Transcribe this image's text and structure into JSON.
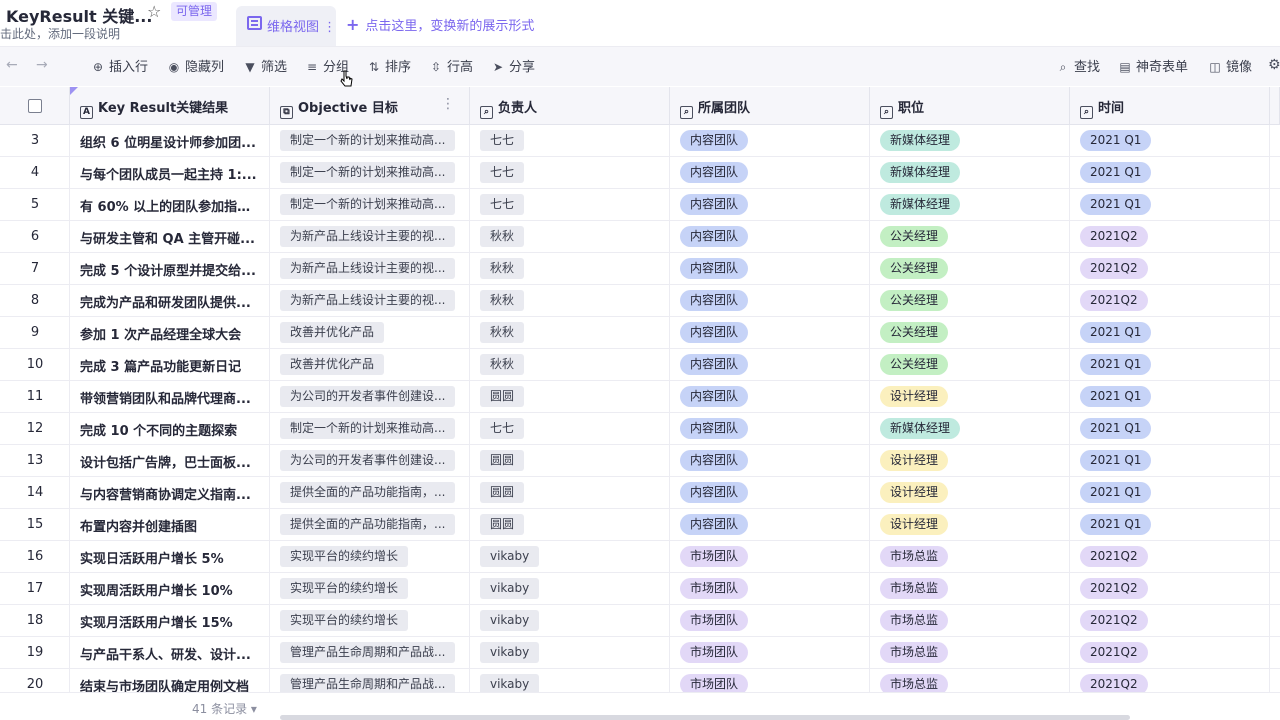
{
  "header": {
    "title": "KeyResult 关键...",
    "badge": "可管理",
    "subtitle": "击此处，添加一段说明",
    "view_tab": "维格视图",
    "add_view": "点击这里，变换新的展示形式"
  },
  "toolbar": {
    "insert_row": "插入行",
    "hide_cols": "隐藏列",
    "filter": "筛选",
    "group": "分组",
    "sort": "排序",
    "row_height": "行高",
    "share": "分享",
    "search": "查找",
    "form": "神奇表单",
    "mirror": "镜像"
  },
  "columns": {
    "kr": "Key Result关键结果",
    "objective": "Objective 目标",
    "owner": "负责人",
    "team": "所属团队",
    "position": "职位",
    "time": "时间"
  },
  "colors": {
    "accent": "#7b67ee",
    "team_content": "#c6d3f7",
    "team_market": "#e2d8f7",
    "pos_newmedia": "#bfeadf",
    "pos_pr": "#c3efc3",
    "pos_design": "#fbf0be",
    "pos_market": "#e2d8f7",
    "time_q1": "#c6d3f7",
    "time_q2": "#e2d8f7"
  },
  "rows": [
    {
      "num": "3",
      "kr": "组织 6 位明星设计师参加团...",
      "obj": "制定一个新的计划来推动高...",
      "owner": "七七",
      "team": "内容团队",
      "pos": "新媒体经理",
      "time": "2021 Q1"
    },
    {
      "num": "4",
      "kr": "与每个团队成员一起主持 1:...",
      "obj": "制定一个新的计划来推动高...",
      "owner": "七七",
      "team": "内容团队",
      "pos": "新媒体经理",
      "time": "2021 Q1"
    },
    {
      "num": "5",
      "kr": "有 60% 以上的团队参加指导...",
      "obj": "制定一个新的计划来推动高...",
      "owner": "七七",
      "team": "内容团队",
      "pos": "新媒体经理",
      "time": "2021 Q1"
    },
    {
      "num": "6",
      "kr": "与研发主管和 QA 主管开碰...",
      "obj": "为新产品上线设计主要的视...",
      "owner": "秋秋",
      "team": "内容团队",
      "pos": "公关经理",
      "time": "2021Q2"
    },
    {
      "num": "7",
      "kr": "完成 5 个设计原型并提交给...",
      "obj": "为新产品上线设计主要的视...",
      "owner": "秋秋",
      "team": "内容团队",
      "pos": "公关经理",
      "time": "2021Q2"
    },
    {
      "num": "8",
      "kr": "完成为产品和研发团队提供...",
      "obj": "为新产品上线设计主要的视...",
      "owner": "秋秋",
      "team": "内容团队",
      "pos": "公关经理",
      "time": "2021Q2"
    },
    {
      "num": "9",
      "kr": "参加 1 次产品经理全球大会",
      "obj": "改善并优化产品",
      "owner": "秋秋",
      "team": "内容团队",
      "pos": "公关经理",
      "time": "2021 Q1"
    },
    {
      "num": "10",
      "kr": "完成 3 篇产品功能更新日记",
      "obj": "改善并优化产品",
      "owner": "秋秋",
      "team": "内容团队",
      "pos": "公关经理",
      "time": "2021 Q1"
    },
    {
      "num": "11",
      "kr": "带领营销团队和品牌代理商...",
      "obj": "为公司的开发者事件创建设...",
      "owner": "圆圆",
      "team": "内容团队",
      "pos": "设计经理",
      "time": "2021 Q1"
    },
    {
      "num": "12",
      "kr": "完成 10 个不同的主题探索",
      "obj": "制定一个新的计划来推动高...",
      "owner": "七七",
      "team": "内容团队",
      "pos": "新媒体经理",
      "time": "2021 Q1"
    },
    {
      "num": "13",
      "kr": "设计包括广告牌，巴士面板...",
      "obj": "为公司的开发者事件创建设...",
      "owner": "圆圆",
      "team": "内容团队",
      "pos": "设计经理",
      "time": "2021 Q1"
    },
    {
      "num": "14",
      "kr": "与内容营销商协调定义指南...",
      "obj": "提供全面的产品功能指南，...",
      "owner": "圆圆",
      "team": "内容团队",
      "pos": "设计经理",
      "time": "2021 Q1"
    },
    {
      "num": "15",
      "kr": "布置内容并创建插图",
      "obj": "提供全面的产品功能指南，...",
      "owner": "圆圆",
      "team": "内容团队",
      "pos": "设计经理",
      "time": "2021 Q1"
    },
    {
      "num": "16",
      "kr": "实现日活跃用户增长 5%",
      "obj": "实现平台的续约增长",
      "owner": "vikaby",
      "team": "市场团队",
      "pos": "市场总监",
      "time": "2021Q2"
    },
    {
      "num": "17",
      "kr": "实现周活跃用户增长 10%",
      "obj": "实现平台的续约增长",
      "owner": "vikaby",
      "team": "市场团队",
      "pos": "市场总监",
      "time": "2021Q2"
    },
    {
      "num": "18",
      "kr": "实现月活跃用户增长 15%",
      "obj": "实现平台的续约增长",
      "owner": "vikaby",
      "team": "市场团队",
      "pos": "市场总监",
      "time": "2021Q2"
    },
    {
      "num": "19",
      "kr": "与产品干系人、研发、设计...",
      "obj": "管理产品生命周期和产品战...",
      "owner": "vikaby",
      "team": "市场团队",
      "pos": "市场总监",
      "time": "2021Q2"
    },
    {
      "num": "20",
      "kr": "结束与市场团队确定用例文档",
      "obj": "管理产品生命周期和产品战...",
      "owner": "vikaby",
      "team": "市场团队",
      "pos": "市场总监",
      "time": "2021Q2"
    }
  ],
  "footer": {
    "count": "41 条记录"
  }
}
